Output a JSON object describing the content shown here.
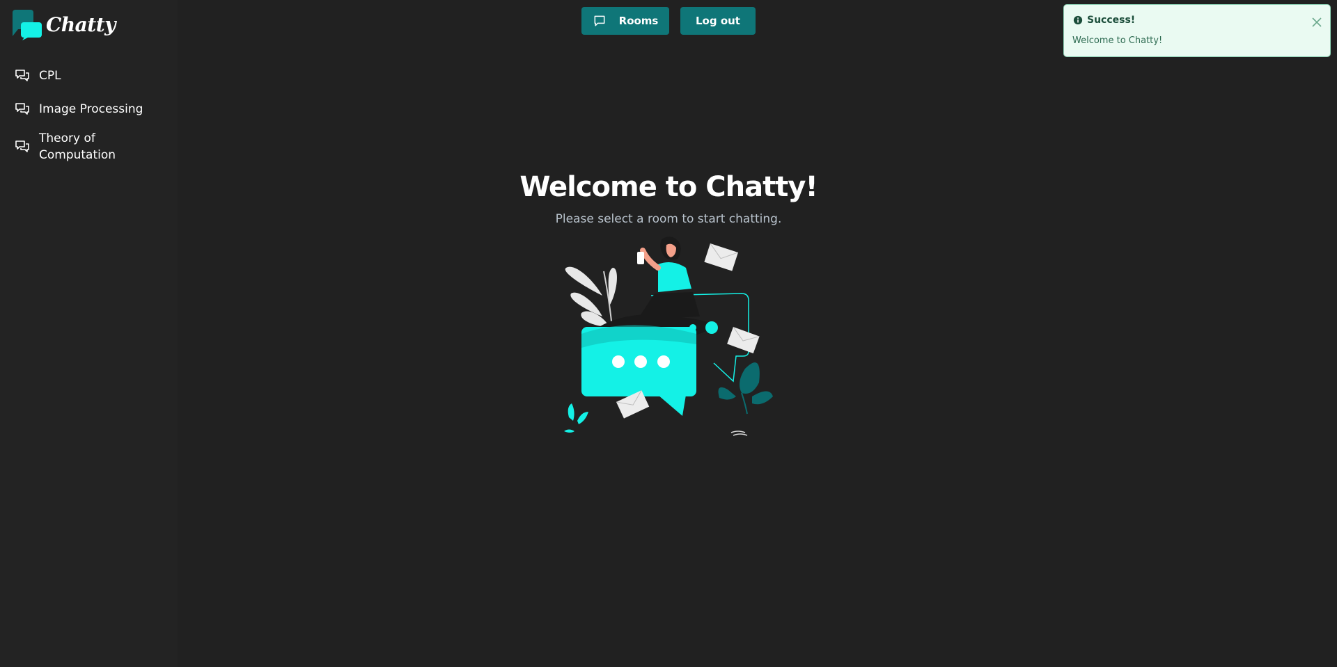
{
  "app": {
    "logo_text": "Chatty"
  },
  "sidebar": {
    "rooms": [
      {
        "label": "CPL"
      },
      {
        "label": "Image Processing"
      },
      {
        "label": "Theory of Computation"
      }
    ]
  },
  "toolbar": {
    "rooms_label": "Rooms",
    "logout_label": "Log out"
  },
  "toast": {
    "title": "Success!",
    "message": "Welcome to Chatty!"
  },
  "main": {
    "title": "Welcome to Chatty!",
    "subtitle": "Please select a room to start chatting."
  },
  "colors": {
    "background": "#212121",
    "accent": "#0f7678",
    "cyan": "#14f1e6",
    "toast_bg": "#eafaf2"
  }
}
